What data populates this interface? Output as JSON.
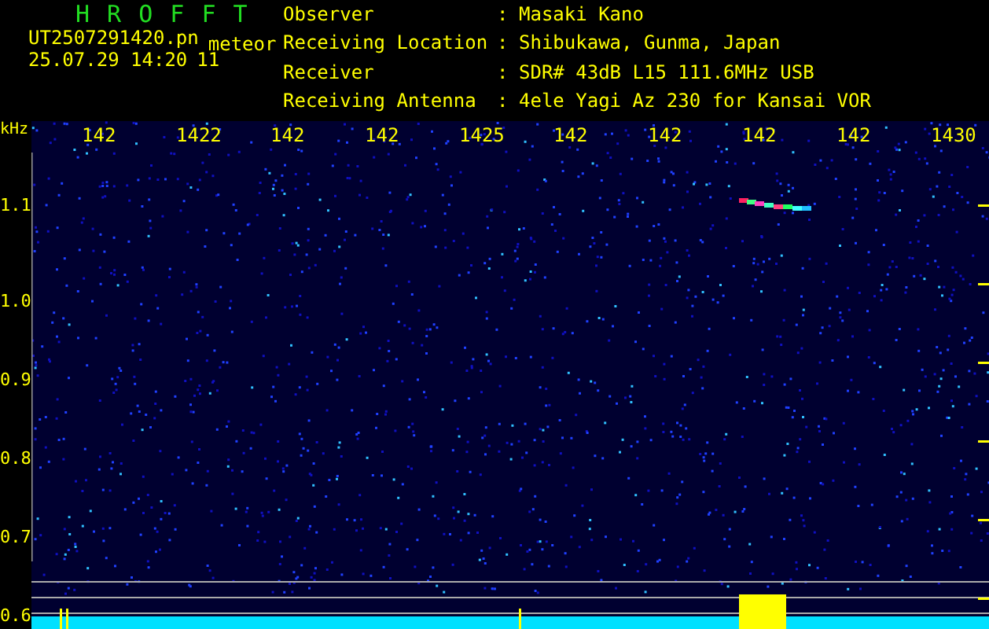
{
  "header": {
    "title": "H R O F F T",
    "filename": "UT2507291420.pn",
    "filename_suffix": "meteor",
    "datetime": "25.07.29 14:20",
    "count": "11",
    "info": [
      {
        "label": "Observer",
        "separator": ":",
        "value": "Masaki Kano"
      },
      {
        "label": "Receiving Location",
        "separator": ":",
        "value": "Shibukawa, Gunma, Japan"
      },
      {
        "label": "Receiver",
        "separator": ":",
        "value": "SDR# 43dB L15 111.6MHz USB"
      },
      {
        "label": "Receiving Antenna",
        "separator": ":",
        "value": "4ele Yagi Az 230 for Kansai VOR"
      }
    ]
  },
  "plot": {
    "y_unit": "kHz",
    "y_labels": [
      "1.1",
      "1.0",
      "0.9",
      "0.8",
      "0.7",
      "0.6"
    ],
    "x_labels": [
      "142",
      "1422",
      "142",
      "142",
      "1425",
      "142",
      "142",
      "142",
      "142",
      "1430"
    ]
  }
}
